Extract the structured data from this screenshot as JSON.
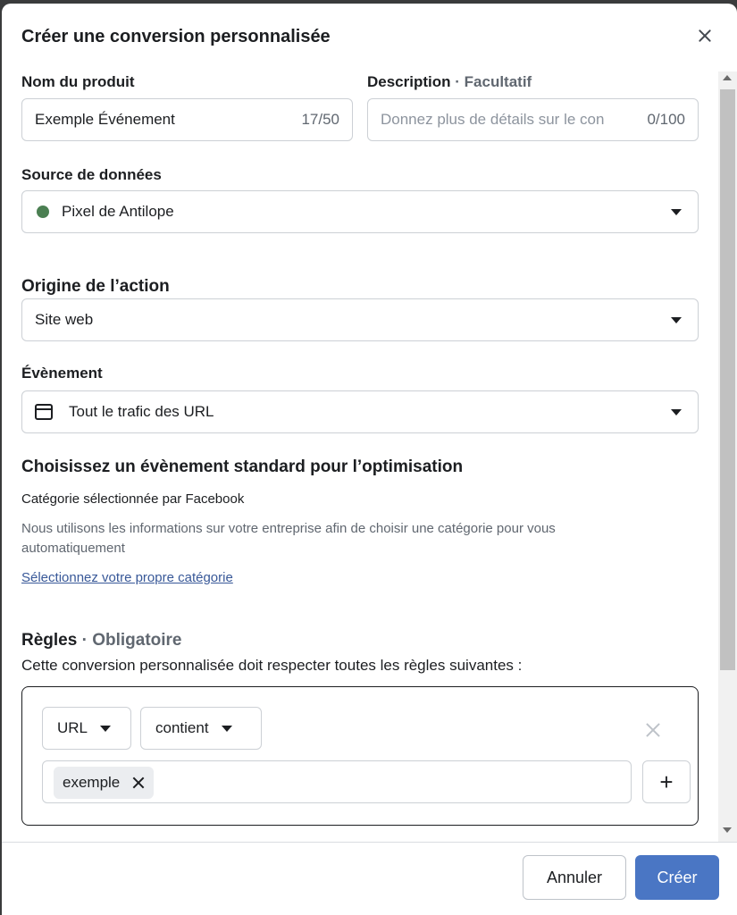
{
  "dialog": {
    "title": "Créer une conversion personnalisée"
  },
  "fields": {
    "product_name": {
      "label": "Nom du produit",
      "value": "Exemple Événement",
      "count": "17/50"
    },
    "description": {
      "label": "Description",
      "optional": "· Facultatif",
      "placeholder": "Donnez plus de détails sur le con",
      "count": "0/100"
    },
    "data_source": {
      "label": "Source de données",
      "value": "Pixel de Antilope",
      "status_color": "#4b7f52"
    },
    "action_origin": {
      "label": "Origine de l’action",
      "value": "Site web"
    },
    "event": {
      "label": "Évènement",
      "value": "Tout le trafic des URL"
    }
  },
  "optimization": {
    "heading": "Choisissez un évènement standard pour l’optimisation",
    "selected_by": "Catégorie sélectionnée par Facebook",
    "info": "Nous utilisons les informations sur votre entreprise afin de choisir une catégorie pour vous automatiquement",
    "link": "Sélectionnez votre propre catégorie"
  },
  "rules": {
    "label": "Règles",
    "required": "· Obligatoire",
    "description": "Cette conversion personnalisée doit respecter toutes les règles suivantes :",
    "field_select": "URL",
    "operator_select": "contient",
    "tags": [
      "exemple"
    ],
    "add_label": "+"
  },
  "footer": {
    "cancel": "Annuler",
    "create": "Créer",
    "primary_color": "#4a76c4"
  }
}
